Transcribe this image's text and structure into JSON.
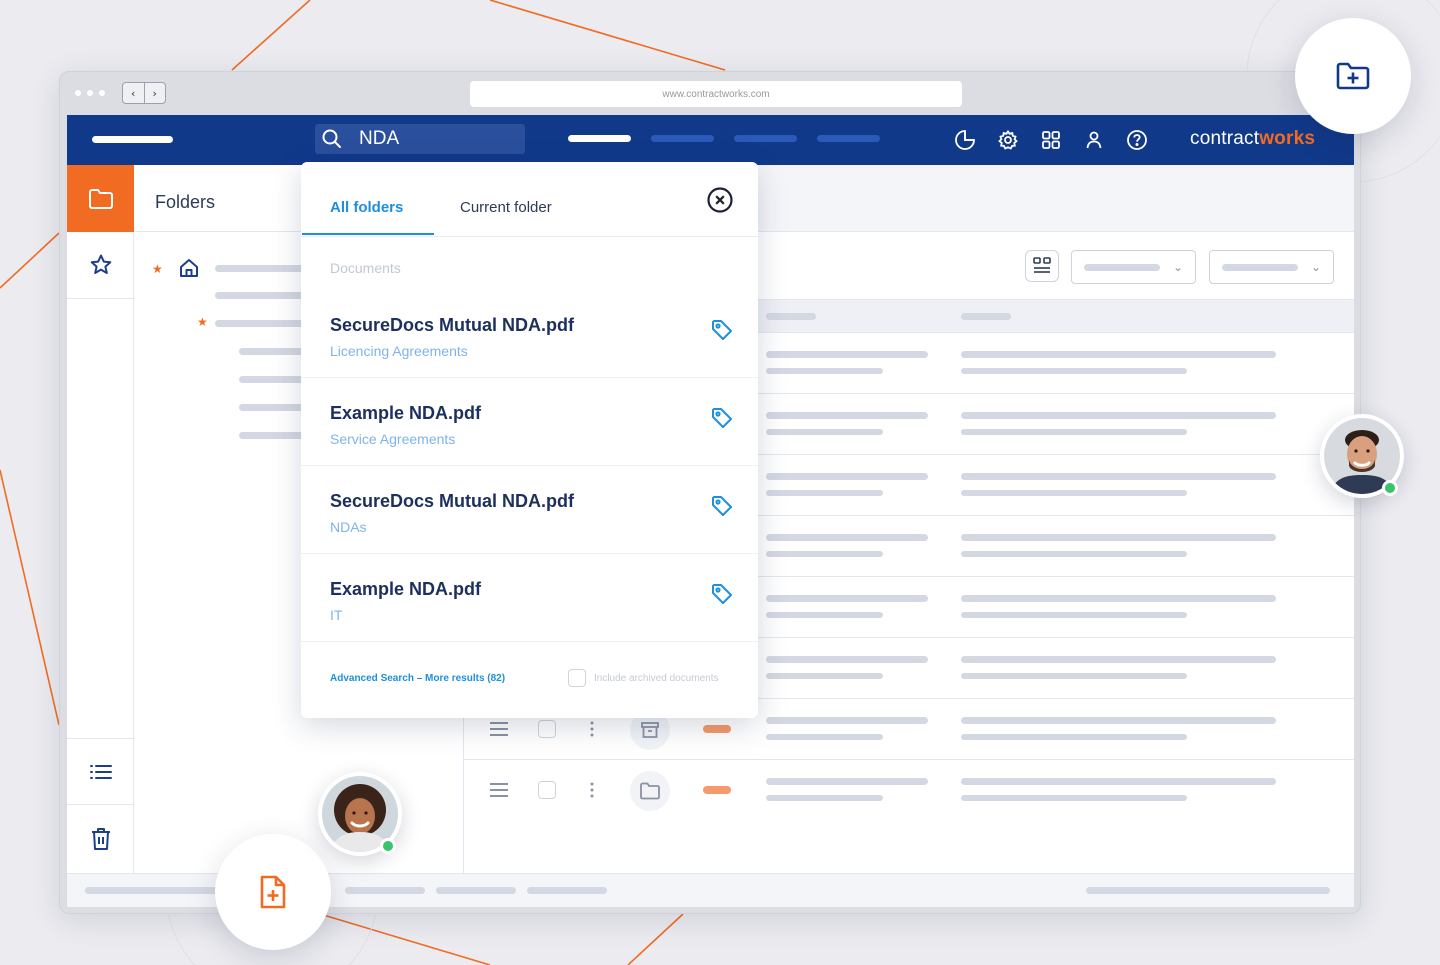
{
  "browser": {
    "url": "www.contractworks.com",
    "back_glyph": "‹",
    "forward_glyph": "›"
  },
  "topbar": {
    "search_query": "NDA",
    "brand_prefix": "contract",
    "brand_suffix": "works",
    "icons": [
      "pie-chart-icon",
      "gear-icon",
      "apps-grid-icon",
      "user-icon",
      "help-icon"
    ]
  },
  "sidebar": {
    "folders_title": "Folders"
  },
  "search_dropdown": {
    "tabs": [
      {
        "label": "All folders",
        "active": true
      },
      {
        "label": "Current folder",
        "active": false
      }
    ],
    "section_label": "Documents",
    "results": [
      {
        "name": "SecureDocs Mutual NDA.pdf",
        "folder": "Licencing Agreements"
      },
      {
        "name": "Example NDA.pdf",
        "folder": "Service Agreements"
      },
      {
        "name": "SecureDocs Mutual NDA.pdf",
        "folder": "NDAs"
      },
      {
        "name": "Example NDA.pdf",
        "folder": "IT"
      }
    ],
    "advanced_search_label": "Advanced Search – More results (82)",
    "include_archived_label": "Include archived documents"
  },
  "colors": {
    "navy": "#11398a",
    "orange": "#f26b22",
    "link_blue": "#1e8fde",
    "online_green": "#37c46b"
  }
}
